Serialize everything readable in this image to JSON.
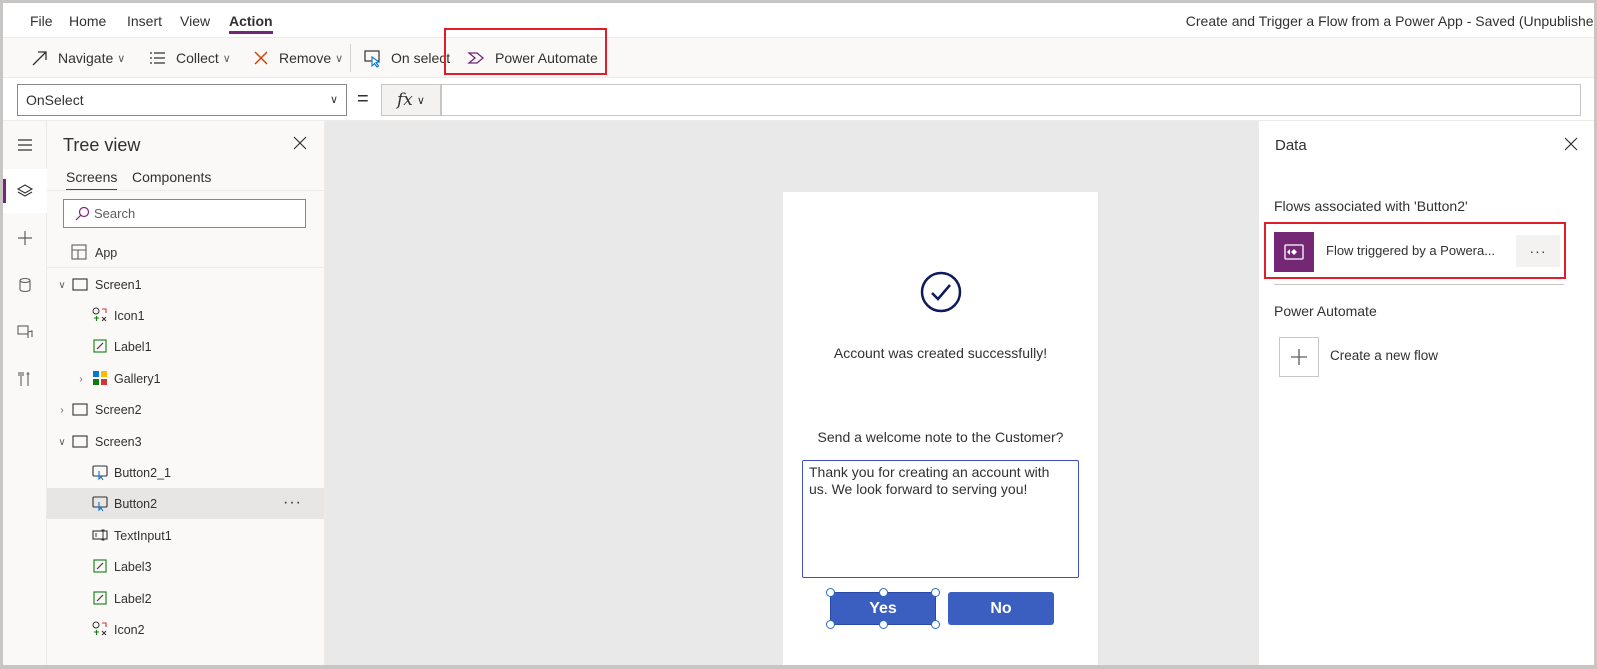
{
  "menubar": {
    "items": [
      "File",
      "Home",
      "Insert",
      "View",
      "Action"
    ],
    "active": "Action",
    "app_title": "Create and Trigger a Flow from a Power App - Saved (Unpublished)"
  },
  "toolbar": {
    "navigate": "Navigate",
    "collect": "Collect",
    "remove": "Remove",
    "on_select": "On select",
    "power_automate": "Power Automate"
  },
  "formulabar": {
    "property": "OnSelect",
    "equals": "=",
    "fx": "fx",
    "formula": ""
  },
  "tree": {
    "title": "Tree view",
    "tabs": [
      "Screens",
      "Components"
    ],
    "search_placeholder": "Search",
    "app_label": "App",
    "rows": [
      {
        "label": "Screen1"
      },
      {
        "label": "Icon1"
      },
      {
        "label": "Label1"
      },
      {
        "label": "Gallery1"
      },
      {
        "label": "Screen2"
      },
      {
        "label": "Screen3"
      },
      {
        "label": "Button2_1"
      },
      {
        "label": "Button2"
      },
      {
        "label": "TextInput1"
      },
      {
        "label": "Label3"
      },
      {
        "label": "Label2"
      },
      {
        "label": "Icon2"
      }
    ],
    "more_label": "···"
  },
  "canvas": {
    "success_message": "Account was created successfully!",
    "prompt": "Send a welcome note to the Customer?",
    "note_text": "Thank you for creating an account with us. We look forward to serving you!",
    "yes_label": "Yes",
    "no_label": "No"
  },
  "data_panel": {
    "title": "Data",
    "flows_heading": "Flows associated with 'Button2'",
    "flow_name": "Flow triggered by a Powera...",
    "flow_more": "···",
    "section_power_automate": "Power Automate",
    "create_label": "Create a new flow"
  },
  "colors": {
    "accent": "#742774",
    "highlight": "#e01e2a",
    "button": "#3a5fc0",
    "icon_navy": "#0f1a5a"
  }
}
